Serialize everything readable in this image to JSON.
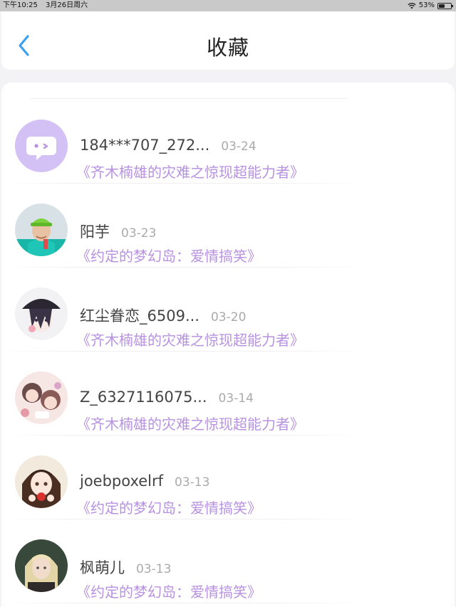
{
  "status_bar": {
    "time": "下午10:25",
    "date": "3月26日周六",
    "battery": "53%",
    "battery_level": 0.53
  },
  "header": {
    "title": "收藏",
    "back_icon": "chevron-left-icon"
  },
  "colors": {
    "accent": "#3aa0f0",
    "work_title": "#b892e0",
    "date": "#aaaaaa"
  },
  "favorites": [
    {
      "user": "184***707_272...",
      "date": "03-24",
      "work": "《齐木楠雄的灾难之惊现超能力者》",
      "avatar": "chat-bubble-avatar"
    },
    {
      "user": "阳芋",
      "date": "03-23",
      "work": "《约定的梦幻岛：爱情搞笑》",
      "avatar": "green-cap-boy-avatar"
    },
    {
      "user": "红尘眷恋_6509...",
      "date": "03-20",
      "work": "《齐木楠雄的灾难之惊现超能力者》",
      "avatar": "anime-boy-hat-avatar"
    },
    {
      "user": "Z_6327116075...",
      "date": "03-14",
      "work": "《齐木楠雄的灾难之惊现超能力者》",
      "avatar": "anime-pair-avatar"
    },
    {
      "user": "joebpoxelrf",
      "date": "03-13",
      "work": "《约定的梦幻岛：爱情搞笑》",
      "avatar": "anime-girl-apple-avatar"
    },
    {
      "user": "枫萌儿",
      "date": "03-13",
      "work": "《约定的梦幻岛：爱情搞笑》",
      "avatar": "blonde-girl-avatar"
    }
  ]
}
